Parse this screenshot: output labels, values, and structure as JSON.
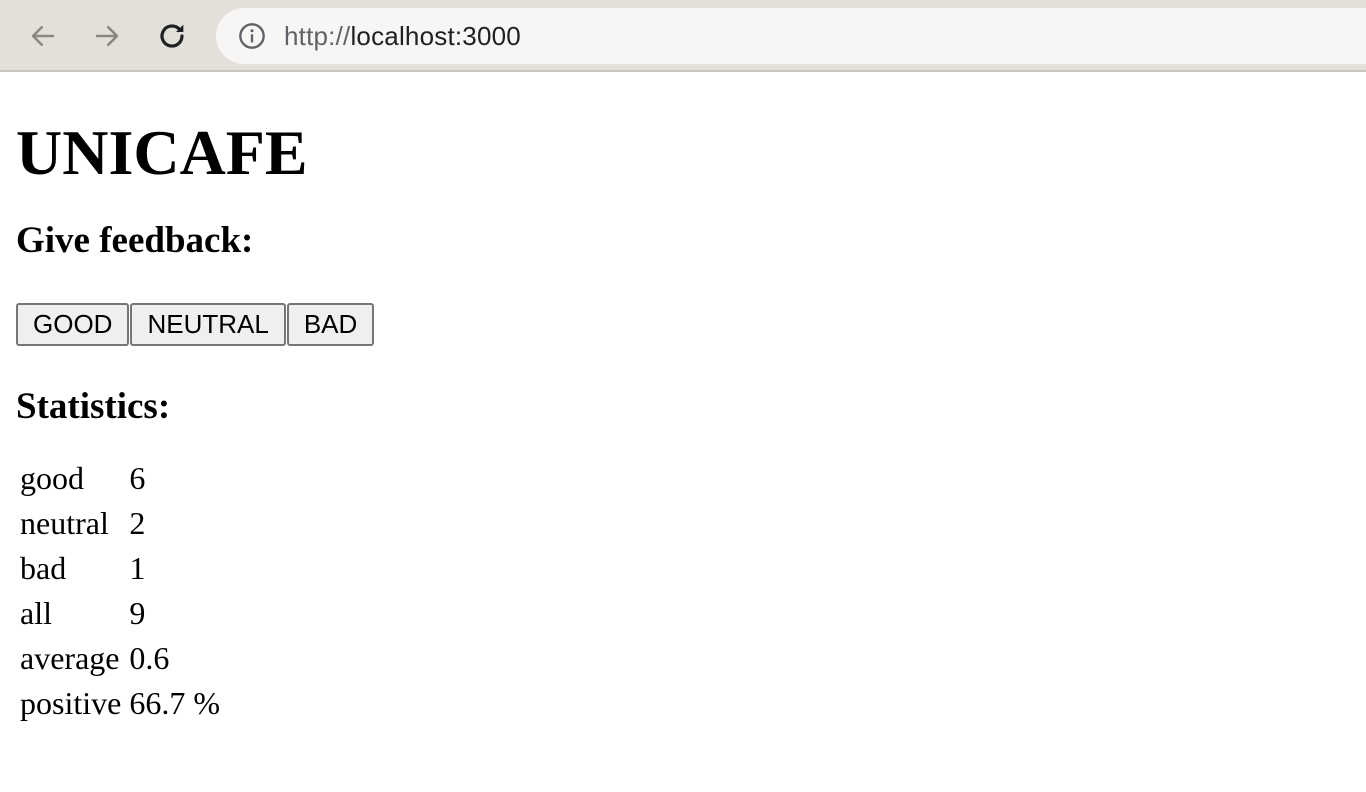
{
  "browser": {
    "url_scheme": "http://",
    "url_host": "localhost:3000"
  },
  "page": {
    "title": "UNICAFE",
    "feedback_heading": "Give feedback:",
    "buttons": {
      "good": "GOOD",
      "neutral": "NEUTRAL",
      "bad": "BAD"
    },
    "statistics_heading": "Statistics:",
    "statistics": [
      {
        "label": "good",
        "value": "6"
      },
      {
        "label": "neutral",
        "value": "2"
      },
      {
        "label": "bad",
        "value": "1"
      },
      {
        "label": "all",
        "value": "9"
      },
      {
        "label": "average",
        "value": "0.6"
      },
      {
        "label": "positive",
        "value": "66.7 %"
      }
    ]
  },
  "icons": {
    "back": "arrow-left-icon",
    "forward": "arrow-right-icon",
    "reload": "reload-icon",
    "info": "info-icon"
  },
  "colors": {
    "chrome_background": "#e3dfd9",
    "address_bar_background": "#f7f6f4",
    "button_background": "#efefef",
    "button_border": "#767676"
  }
}
